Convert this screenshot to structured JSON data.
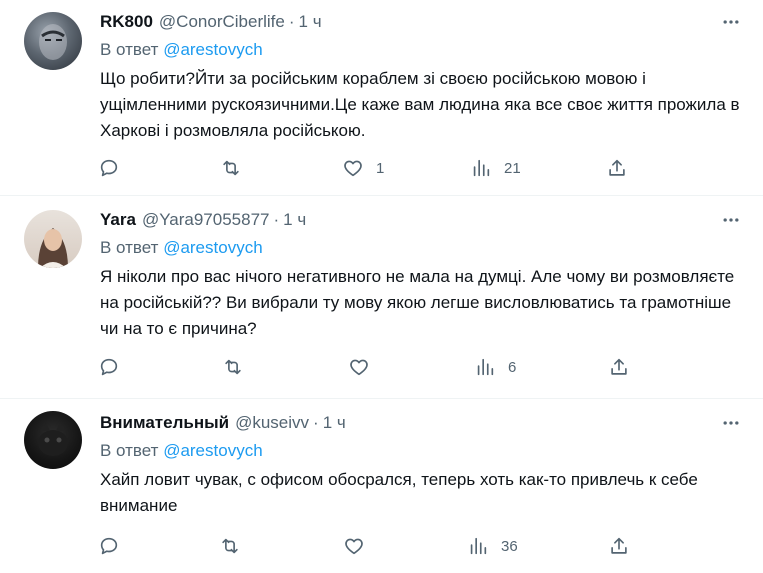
{
  "colors": {
    "text": "#0f1419",
    "secondary": "#536471",
    "link": "#1d9bf0",
    "divider": "#eff3f4"
  },
  "tweets": [
    {
      "name": "RK800",
      "handle": "@ConorCiberlife",
      "dot": "·",
      "time": "1 ч",
      "reply_prefix": "В ответ",
      "reply_to": "@arestovych",
      "text": "Що робити?Йти за російським кораблем зі своєю російською мовою і ущімленними рускоязичними.Це каже вам людина яка все своє життя прожила в Харкові і розмовляла російською.",
      "likes": "1",
      "views": "21"
    },
    {
      "name": "Yara",
      "handle": "@Yara97055877",
      "dot": "·",
      "time": "1 ч",
      "reply_prefix": "В ответ",
      "reply_to": "@arestovych",
      "text": "Я ніколи про вас нічого негативного не мала на думці. Але чому ви розмовляєте на російській?? Ви вибрали ту мову якою легше висловлюватись та грамотніше чи на то є причина?",
      "likes": "",
      "views": "6"
    },
    {
      "name": "Внимательный",
      "handle": "@kuseivv",
      "dot": "·",
      "time": "1 ч",
      "reply_prefix": "В ответ",
      "reply_to": "@arestovych",
      "text": "Хайп ловит чувак, с офисом обосрался, теперь хоть как-то привлечь к себе внимание",
      "likes": "",
      "views": "36"
    }
  ],
  "icons": [
    "more-icon",
    "reply-icon",
    "retweet-icon",
    "like-icon",
    "views-icon",
    "share-icon"
  ]
}
